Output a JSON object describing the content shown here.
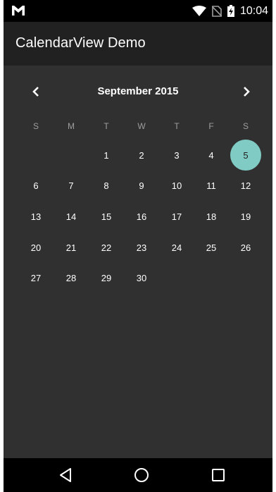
{
  "status_bar": {
    "time": "10:04",
    "icons": [
      "gmail-icon",
      "wifi-icon",
      "no-sim-icon",
      "battery-charging-icon"
    ]
  },
  "toolbar": {
    "title": "CalendarView Demo"
  },
  "calendar": {
    "month_label": "September 2015",
    "prev_icon": "chevron-left-icon",
    "next_icon": "chevron-right-icon",
    "weekdays": [
      "S",
      "M",
      "T",
      "W",
      "T",
      "F",
      "S"
    ],
    "weeks": [
      [
        "",
        "",
        "1",
        "2",
        "3",
        "4",
        "5"
      ],
      [
        "6",
        "7",
        "8",
        "9",
        "10",
        "11",
        "12"
      ],
      [
        "13",
        "14",
        "15",
        "16",
        "17",
        "18",
        "19"
      ],
      [
        "20",
        "21",
        "22",
        "23",
        "24",
        "25",
        "26"
      ],
      [
        "27",
        "28",
        "29",
        "30",
        "",
        "",
        ""
      ]
    ],
    "selected_day": "5",
    "selection_color": "#80cbc4"
  },
  "nav_bar": {
    "icons": [
      "back-icon",
      "home-icon",
      "recents-icon"
    ]
  }
}
